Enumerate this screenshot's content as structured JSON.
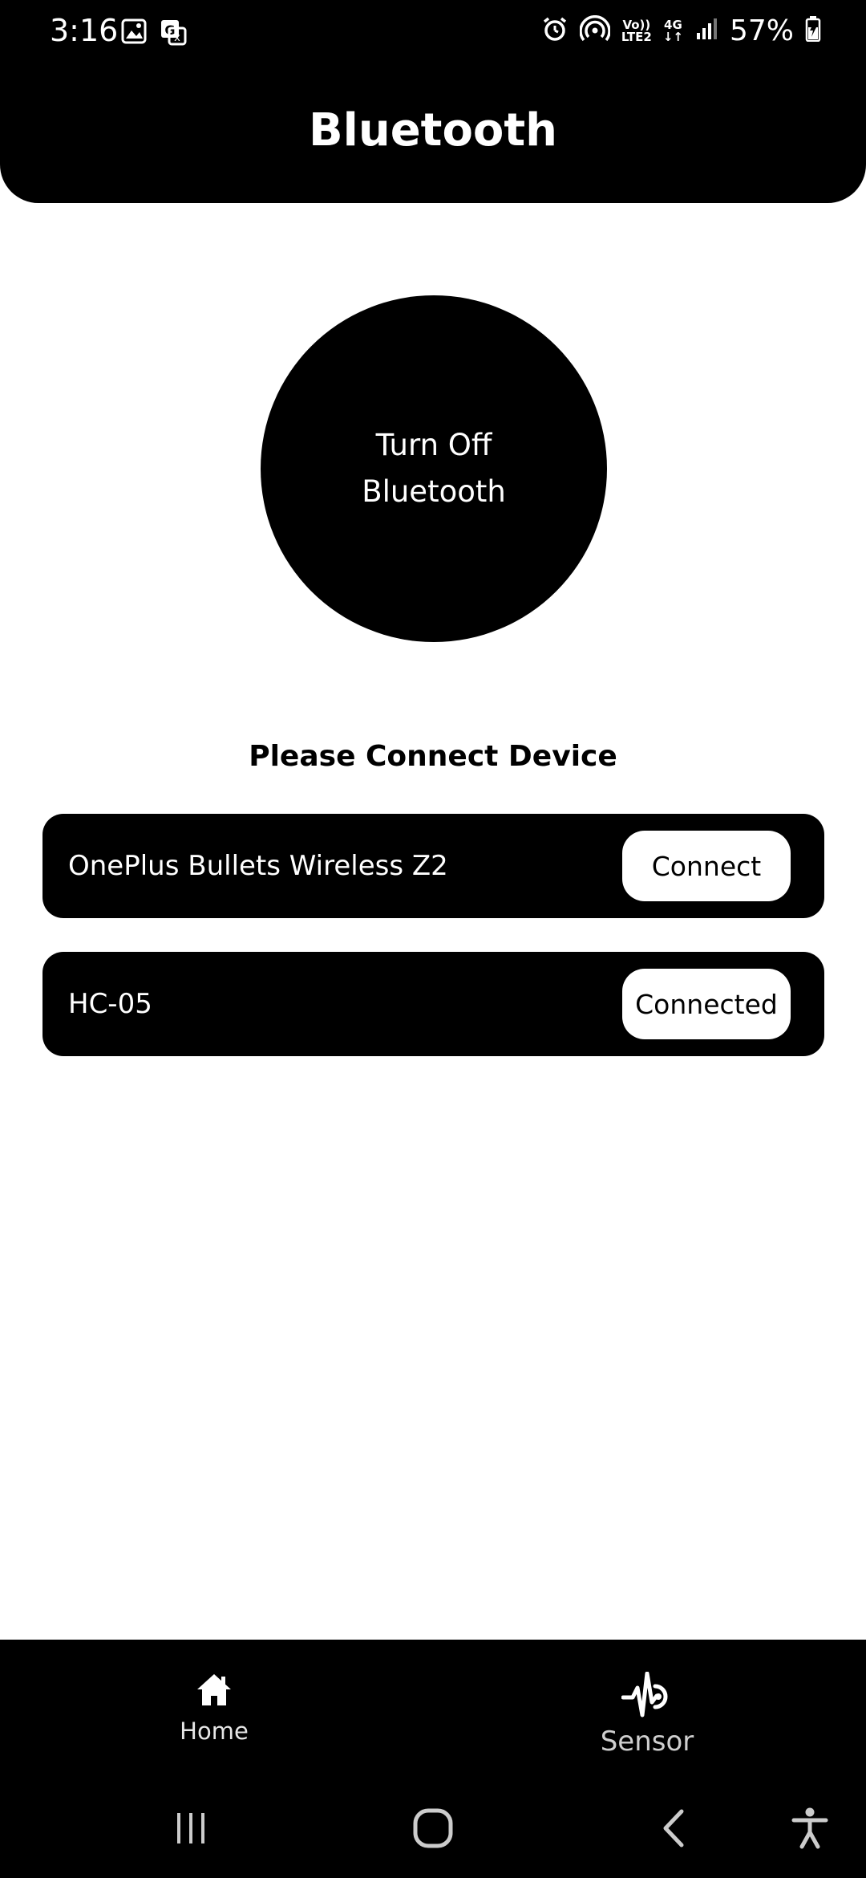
{
  "status_bar": {
    "time": "3:16",
    "volte_label_top": "Vo))",
    "volte_label_bottom": "LTE2",
    "network_label": "4G",
    "battery": "57%"
  },
  "header": {
    "title": "Bluetooth"
  },
  "toggle": {
    "label": "Turn Off Bluetooth"
  },
  "devices_section": {
    "title": "Please Connect Device",
    "devices": [
      {
        "name": "OnePlus Bullets Wireless Z2",
        "button_label": "Connect"
      },
      {
        "name": "HC-05",
        "button_label": "Connected"
      }
    ]
  },
  "bottom_nav": {
    "items": [
      {
        "label": "Home",
        "icon": "home-icon"
      },
      {
        "label": "Sensor",
        "icon": "sensor-icon"
      }
    ]
  },
  "system_nav": {
    "buttons": [
      "recents-icon",
      "home-circle-icon",
      "back-icon",
      "accessibility-icon"
    ]
  },
  "colors": {
    "primary": "#000000",
    "background": "#ffffff",
    "on_primary": "#ffffff"
  }
}
